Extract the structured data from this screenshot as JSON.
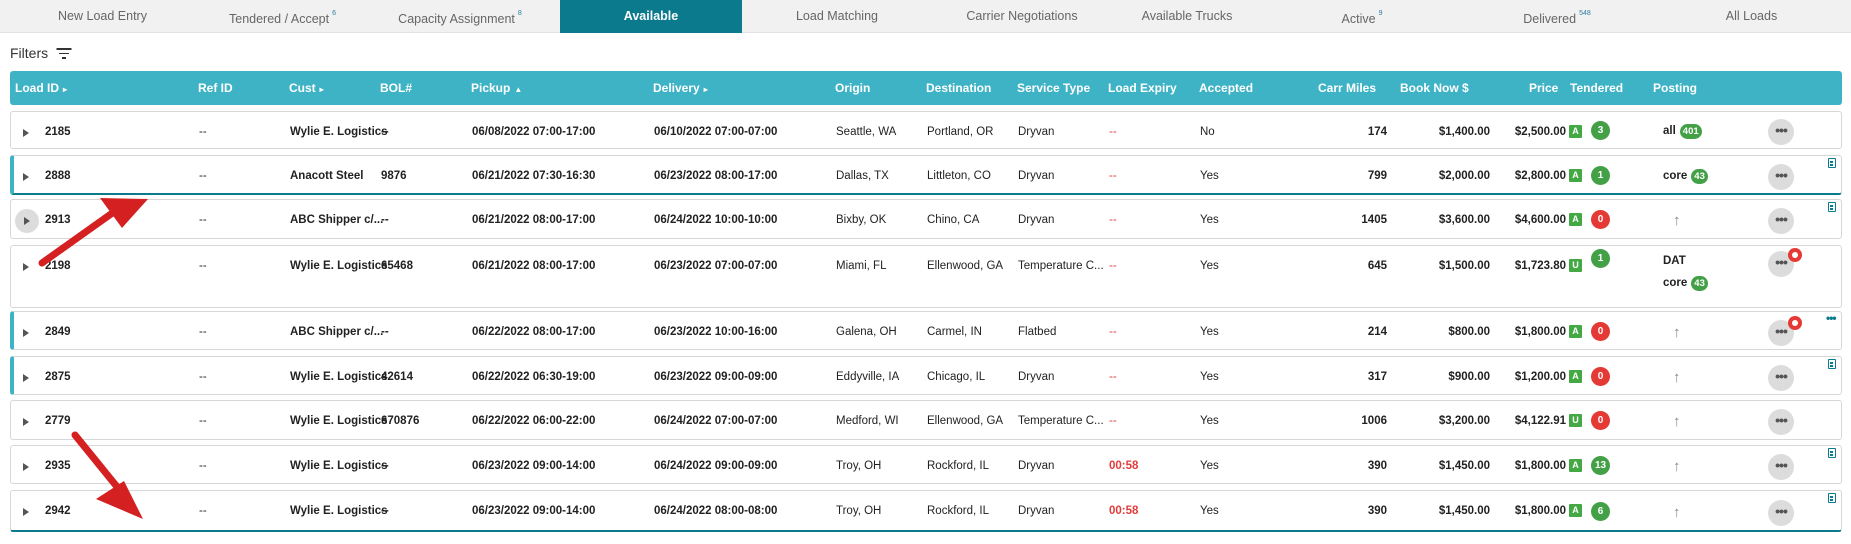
{
  "tabs": [
    {
      "label": "New Load Entry",
      "count": ""
    },
    {
      "label": "Tendered / Accept",
      "count": "6"
    },
    {
      "label": "Capacity Assignment",
      "count": "8"
    },
    {
      "label": "Available",
      "count": ""
    },
    {
      "label": "Load Matching",
      "count": ""
    },
    {
      "label": "Carrier Negotiations",
      "count": ""
    },
    {
      "label": "Available Trucks",
      "count": ""
    },
    {
      "label": "Active",
      "count": "9"
    },
    {
      "label": "Delivered",
      "count": "548"
    },
    {
      "label": "All Loads",
      "count": ""
    }
  ],
  "active_tab": "Available",
  "filters": {
    "label": "Filters"
  },
  "columns": {
    "load_id": "Load ID",
    "ref_id": "Ref ID",
    "cust": "Cust",
    "bol": "BOL#",
    "pickup": "Pickup",
    "delivery": "Delivery",
    "origin": "Origin",
    "destination": "Destination",
    "service_type": "Service Type",
    "load_expiry": "Load Expiry",
    "accepted": "Accepted",
    "carr_miles": "Carr Miles",
    "book_now": "Book Now $",
    "price": "Price",
    "tendered": "Tendered",
    "posting": "Posting"
  },
  "rows": [
    {
      "load_id": "2185",
      "ref_id": "--",
      "cust": "Wylie E. Logistics",
      "bol": "--",
      "pickup": "06/08/2022 07:00-17:00",
      "delivery": "06/10/2022 07:00-07:00",
      "origin": "Seattle, WA",
      "destination": "Portland, OR",
      "service_type": "Dryvan",
      "load_expiry": "--",
      "accepted": "No",
      "carr_miles": "174",
      "book_now": "$1,400.00",
      "price": "$2,500.00",
      "price_badge": "A",
      "tendered": "3",
      "tendered_color": "green",
      "posting_lines": [
        {
          "label": "all",
          "count": "401"
        }
      ]
    },
    {
      "load_id": "2888",
      "ref_id": "--",
      "cust": "Anacott Steel",
      "bol": "9876",
      "pickup": "06/21/2022 07:30-16:30",
      "delivery": "06/23/2022 08:00-17:00",
      "origin": "Dallas, TX",
      "destination": "Littleton, CO",
      "service_type": "Dryvan",
      "load_expiry": "--",
      "accepted": "Yes",
      "carr_miles": "799",
      "book_now": "$2,000.00",
      "price": "$2,800.00",
      "price_badge": "A",
      "tendered": "1",
      "tendered_color": "green",
      "posting_lines": [
        {
          "label": "core",
          "count": "43"
        }
      ]
    },
    {
      "load_id": "2913",
      "ref_id": "--",
      "cust": "ABC Shipper c/...",
      "bol": "--",
      "pickup": "06/21/2022 08:00-17:00",
      "delivery": "06/24/2022 10:00-10:00",
      "origin": "Bixby, OK",
      "destination": "Chino, CA",
      "service_type": "Dryvan",
      "load_expiry": "--",
      "accepted": "Yes",
      "carr_miles": "1405",
      "book_now": "$3,600.00",
      "price": "$4,600.00",
      "price_badge": "A",
      "tendered": "0",
      "tendered_color": "red",
      "posting_lines": []
    },
    {
      "load_id": "2198",
      "ref_id": "--",
      "cust": "Wylie E. Logistics",
      "bol": "65468",
      "pickup": "06/21/2022 08:00-17:00",
      "delivery": "06/23/2022 07:00-07:00",
      "origin": "Miami, FL",
      "destination": "Ellenwood, GA",
      "service_type": "Temperature C...",
      "load_expiry": "--",
      "accepted": "Yes",
      "carr_miles": "645",
      "book_now": "$1,500.00",
      "price": "$1,723.80",
      "price_badge": "U",
      "tendered": "1",
      "tendered_color": "green",
      "posting_lines": [
        {
          "label": "DAT",
          "count": ""
        },
        {
          "label": "core",
          "count": "43"
        }
      ]
    },
    {
      "load_id": "2849",
      "ref_id": "--",
      "cust": "ABC Shipper c/...",
      "bol": "--",
      "pickup": "06/22/2022 08:00-17:00",
      "delivery": "06/23/2022 10:00-16:00",
      "origin": "Galena, OH",
      "destination": "Carmel, IN",
      "service_type": "Flatbed",
      "load_expiry": "--",
      "accepted": "Yes",
      "carr_miles": "214",
      "book_now": "$800.00",
      "price": "$1,800.00",
      "price_badge": "A",
      "tendered": "0",
      "tendered_color": "red",
      "posting_lines": []
    },
    {
      "load_id": "2875",
      "ref_id": "--",
      "cust": "Wylie E. Logistics",
      "bol": "42614",
      "pickup": "06/22/2022 06:30-19:00",
      "delivery": "06/23/2022 09:00-09:00",
      "origin": "Eddyville, IA",
      "destination": "Chicago, IL",
      "service_type": "Dryvan",
      "load_expiry": "--",
      "accepted": "Yes",
      "carr_miles": "317",
      "book_now": "$900.00",
      "price": "$1,200.00",
      "price_badge": "A",
      "tendered": "0",
      "tendered_color": "red",
      "posting_lines": []
    },
    {
      "load_id": "2779",
      "ref_id": "--",
      "cust": "Wylie E. Logistics",
      "bol": "670876",
      "pickup": "06/22/2022 06:00-22:00",
      "delivery": "06/24/2022 07:00-07:00",
      "origin": "Medford, WI",
      "destination": "Ellenwood, GA",
      "service_type": "Temperature C...",
      "load_expiry": "--",
      "accepted": "Yes",
      "carr_miles": "1006",
      "book_now": "$3,200.00",
      "price": "$4,122.91",
      "price_badge": "U",
      "tendered": "0",
      "tendered_color": "red",
      "posting_lines": []
    },
    {
      "load_id": "2935",
      "ref_id": "--",
      "cust": "Wylie E. Logistics",
      "bol": "--",
      "pickup": "06/23/2022 09:00-14:00",
      "delivery": "06/24/2022 09:00-09:00",
      "origin": "Troy, OH",
      "destination": "Rockford, IL",
      "service_type": "Dryvan",
      "load_expiry": "00:58",
      "accepted": "Yes",
      "carr_miles": "390",
      "book_now": "$1,450.00",
      "price": "$1,800.00",
      "price_badge": "A",
      "tendered": "13",
      "tendered_color": "green",
      "posting_lines": []
    },
    {
      "load_id": "2942",
      "ref_id": "--",
      "cust": "Wylie E. Logistics",
      "bol": "--",
      "pickup": "06/23/2022 09:00-14:00",
      "delivery": "06/24/2022 08:00-08:00",
      "origin": "Troy, OH",
      "destination": "Rockford, IL",
      "service_type": "Dryvan",
      "load_expiry": "00:58",
      "accepted": "Yes",
      "carr_miles": "390",
      "book_now": "$1,450.00",
      "price": "$1,800.00",
      "price_badge": "A",
      "tendered": "6",
      "tendered_color": "green",
      "posting_lines": []
    }
  ],
  "colors": {
    "accent": "#3fb3c6",
    "active_tab": "#0a7a8c",
    "alert": "#e53935",
    "ok": "#43a047"
  },
  "icons": {
    "filter": "filter-icon",
    "expand": "chevron-right-icon",
    "more": "ellipsis-icon",
    "posting_empty": "arrow-up-icon",
    "notes": "clipboard-icon",
    "alert": "red-dot-icon",
    "annotation": "red-arrow"
  }
}
